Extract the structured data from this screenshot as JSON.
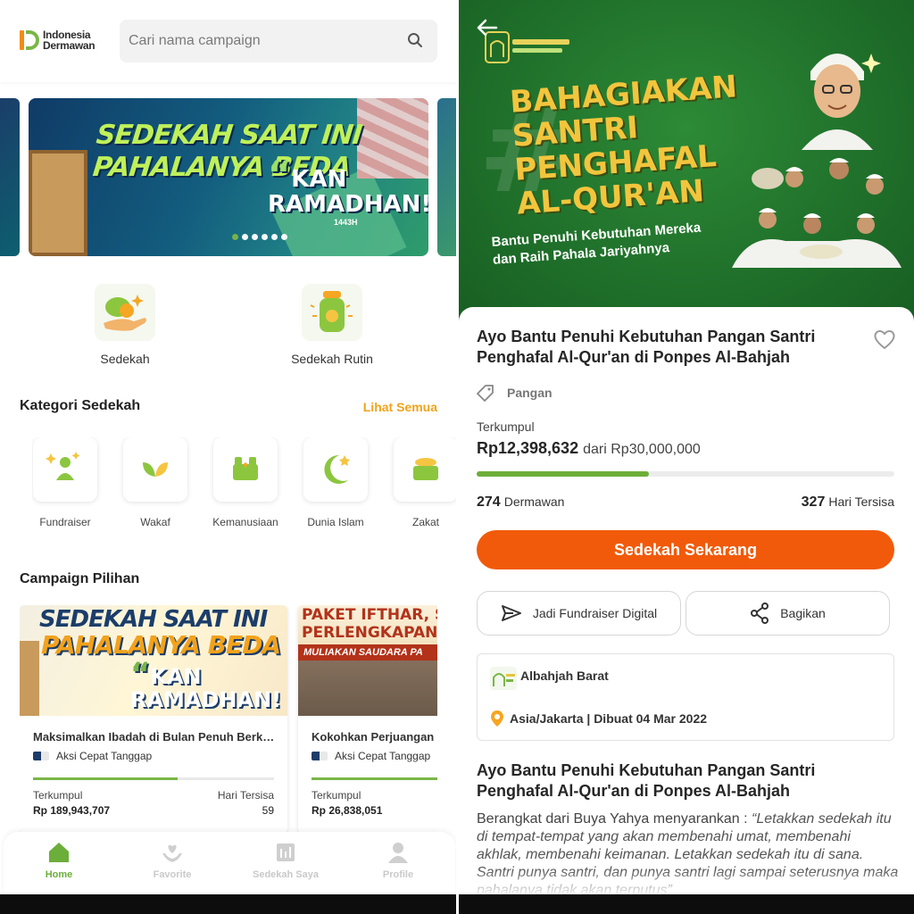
{
  "left": {
    "logo": {
      "line1": "Indonesia",
      "line2": "Dermawan"
    },
    "search": {
      "placeholder": "Cari nama campaign"
    },
    "banner": {
      "title_line1": "SEDEKAH SAAT INI",
      "title_line2": "PAHALANYA BEDA",
      "kan": "KAN",
      "ramadhan": "RAMADHAN!",
      "year": "1443H",
      "slides": 6,
      "active_slide": 0
    },
    "main_menu": [
      {
        "label": "Sedekah",
        "icon": "hand-coin-icon"
      },
      {
        "label": "Sedekah Rutin",
        "icon": "jar-icon"
      }
    ],
    "categories": {
      "title": "Kategori Sedekah",
      "see_all": "Lihat Semua",
      "items": [
        {
          "label": "Fundraiser",
          "icon": "fundraiser-icon"
        },
        {
          "label": "Wakaf",
          "icon": "leaf-icon"
        },
        {
          "label": "Kemanusiaan",
          "icon": "hands-icon"
        },
        {
          "label": "Dunia Islam",
          "icon": "crescent-icon"
        },
        {
          "label": "Zakat",
          "icon": "coins-icon"
        }
      ]
    },
    "campaigns": {
      "title": "Campaign Pilihan",
      "items": [
        {
          "banner_line1": "SEDEKAH SAAT INI",
          "banner_line2": "PAHALANYA BEDA",
          "banner_kan": "KAN",
          "banner_ramadhan": "RAMADHAN!",
          "title": "Maksimalkan Ibadah di Bulan Penuh Berka...",
          "org": "Aksi Cepat Tanggap",
          "collected_label": "Terkumpul",
          "collected": "Rp 189,943,707",
          "days_label": "Hari Tersisa",
          "days": "59",
          "progress": 0.6
        },
        {
          "banner_line1": "PAKET IFTHAR, SA",
          "banner_line2": "PERLENGKAPAN II",
          "banner_line3": "MULIAKAN SAUDARA PA",
          "title": "Kokohkan Perjuangan S",
          "org": "Aksi Cepat Tanggap",
          "collected_label": "Terkumpul",
          "collected": "Rp 26,838,051",
          "progress": 0.55
        }
      ]
    },
    "nav": [
      {
        "label": "Home",
        "icon": "home-icon",
        "active": true
      },
      {
        "label": "Favorite",
        "icon": "heart-hands-icon",
        "active": false
      },
      {
        "label": "Sedekah Saya",
        "icon": "receipt-icon",
        "active": false
      },
      {
        "label": "Profile",
        "icon": "person-icon",
        "active": false
      }
    ]
  },
  "right": {
    "hero": {
      "title_line1": "BAHAGIAKAN",
      "title_line2": "SANTRI",
      "title_line3": "PENGHAFAL",
      "title_line4": "AL-QUR'AN",
      "hash": "#",
      "sub_line1": "Bantu Penuhi Kebutuhan Mereka",
      "sub_line2": "dan Raih Pahala Jariyahnya"
    },
    "title": "Ayo Bantu Penuhi Kebutuhan Pangan Santri Penghafal Al-Qur'an di Ponpes Al-Bahjah",
    "category": "Pangan",
    "collected_label": "Terkumpul",
    "collected": "Rp12,398,632",
    "target_text": "dari Rp30,000,000",
    "progress": 0.413,
    "donors_count": "274",
    "donors_label": "Dermawan",
    "days_count": "327",
    "days_label": "Hari Tersisa",
    "cta": "Sedekah Sekarang",
    "fundraiser_btn": "Jadi Fundraiser Digital",
    "share_btn": "Bagikan",
    "org_name": "Albahjah Barat",
    "org_meta": "Asia/Jakarta | Dibuat 04 Mar 2022",
    "desc_title": "Ayo Bantu Penuhi Kebutuhan Pangan Santri Penghafal Al-Qur'an di Ponpes Al-Bahjah",
    "desc_intro": "Berangkat dari Buya Yahya menyarankan : ",
    "desc_quote": "“Letakkan sedekah itu di tempat-tempat yang akan membenahi umat, membenahi akhlak, membenahi keimanan. Letakkan sedekah itu di sana. Santri punya santri, dan punya santri lagi sampai seterusnya maka pahalanya tidak akan terputus”",
    "colors": {
      "green": "#6cae3a",
      "orange": "#f15a0a",
      "hero_green": "#1f6f2a",
      "gold": "#f2c53d"
    }
  }
}
